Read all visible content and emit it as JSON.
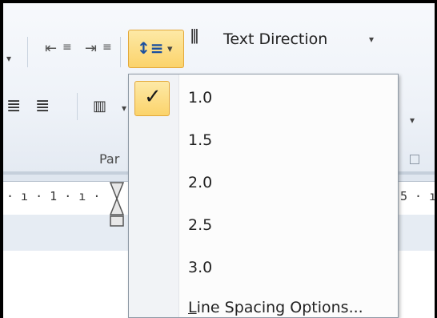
{
  "ribbon": {
    "group_label": "Par",
    "text_direction_label": "Text Direction",
    "text_direction_arrow": "▾",
    "line_spacing_arrow": "▾",
    "line_spacing_glyph": "↕≡",
    "text_direction_glyph": "⫴",
    "dropdown_arrow": "▾"
  },
  "ruler": {
    "left_ticks": "· ı · 1 · ı ·",
    "right_ticks": "5 · ı"
  },
  "line_spacing_menu": {
    "check_glyph": "✓",
    "items": [
      {
        "label": "1.0",
        "checked": true
      },
      {
        "label": "1.5",
        "checked": false
      },
      {
        "label": "2.0",
        "checked": false
      },
      {
        "label": "2.5",
        "checked": false
      },
      {
        "label": "3.0",
        "checked": false
      }
    ],
    "options_label": "Line Spacing Options..."
  }
}
